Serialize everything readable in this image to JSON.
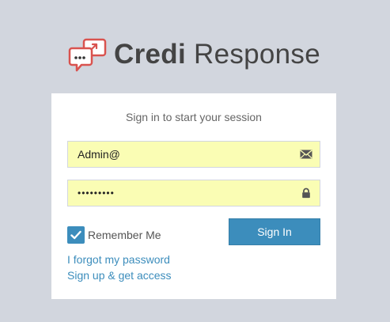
{
  "logo": {
    "brand_bold": "Credi",
    "brand_regular": "Response",
    "icon": "chat-bubbles-share-icon"
  },
  "login": {
    "subtitle": "Sign in to start your session",
    "email": {
      "value": "Admin@",
      "icon": "envelope-icon"
    },
    "password": {
      "value": "•••••••••",
      "icon": "lock-icon"
    },
    "remember_me": {
      "label": "Remember Me",
      "checked": true
    },
    "sign_in_label": "Sign In",
    "forgot_link": "I forgot my password",
    "signup_link": "Sign up & get access"
  },
  "colors": {
    "page_bg": "#d2d6de",
    "primary": "#3c8dbc",
    "field_bg": "#fafdb4",
    "logo_red": "#d9534f",
    "text": "#444444"
  }
}
